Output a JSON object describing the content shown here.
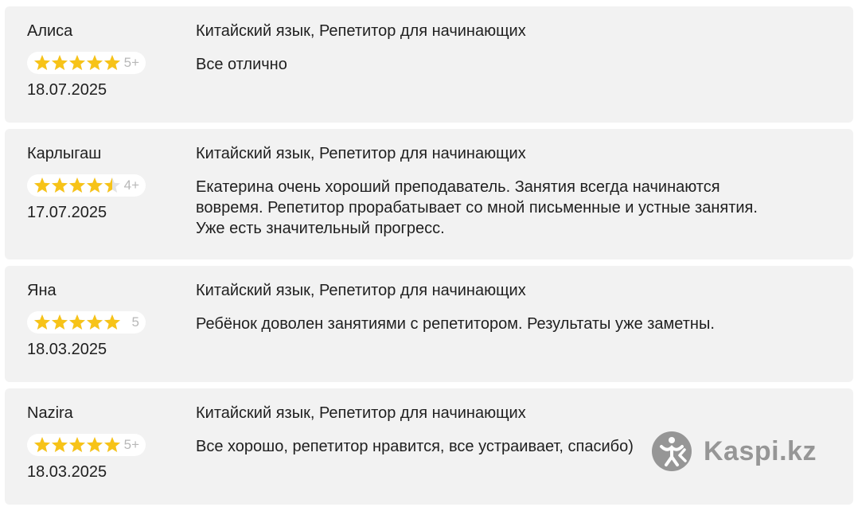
{
  "reviews": [
    {
      "author": "Алиса",
      "rating": 5,
      "rating_label": "5+",
      "date": "18.07.2025",
      "service": "Китайский язык, Репетитор для начинающих",
      "text": "Все отлично"
    },
    {
      "author": "Карлыгаш",
      "rating": 4.5,
      "rating_label": "4+",
      "date": "17.07.2025",
      "service": "Китайский язык, Репетитор для начинающих",
      "text_lines": [
        "Екатерина очень хороший преподаватель. Занятия всегда начинаются",
        "вовремя. Репетитор прорабатывает со мной письменные и устные занятия.",
        "Уже есть значительный прогресс."
      ]
    },
    {
      "author": "Яна",
      "rating": 5,
      "rating_label": "5",
      "date": "18.03.2025",
      "service": "Китайский язык, Репетитор для начинающих",
      "text": "Ребёнок доволен занятиями с репетитором. Результаты уже заметны."
    },
    {
      "author": "Nazira",
      "rating": 5,
      "rating_label": "5+",
      "date": "18.03.2025",
      "service": "Китайский язык, Репетитор для начинающих",
      "text": "Все хорошо, репетитор нравится, все устраивает, спасибо)"
    }
  ],
  "watermark": {
    "text": "Kaspi.kz",
    "logo_icon": "kaspi-logo-icon"
  },
  "colors": {
    "card_background": "#f2f2f2",
    "star_fill": "#f7c318",
    "star_empty": "#e3e3e3",
    "rating_label": "#b8b8b8",
    "watermark": "#8f8f8f"
  }
}
